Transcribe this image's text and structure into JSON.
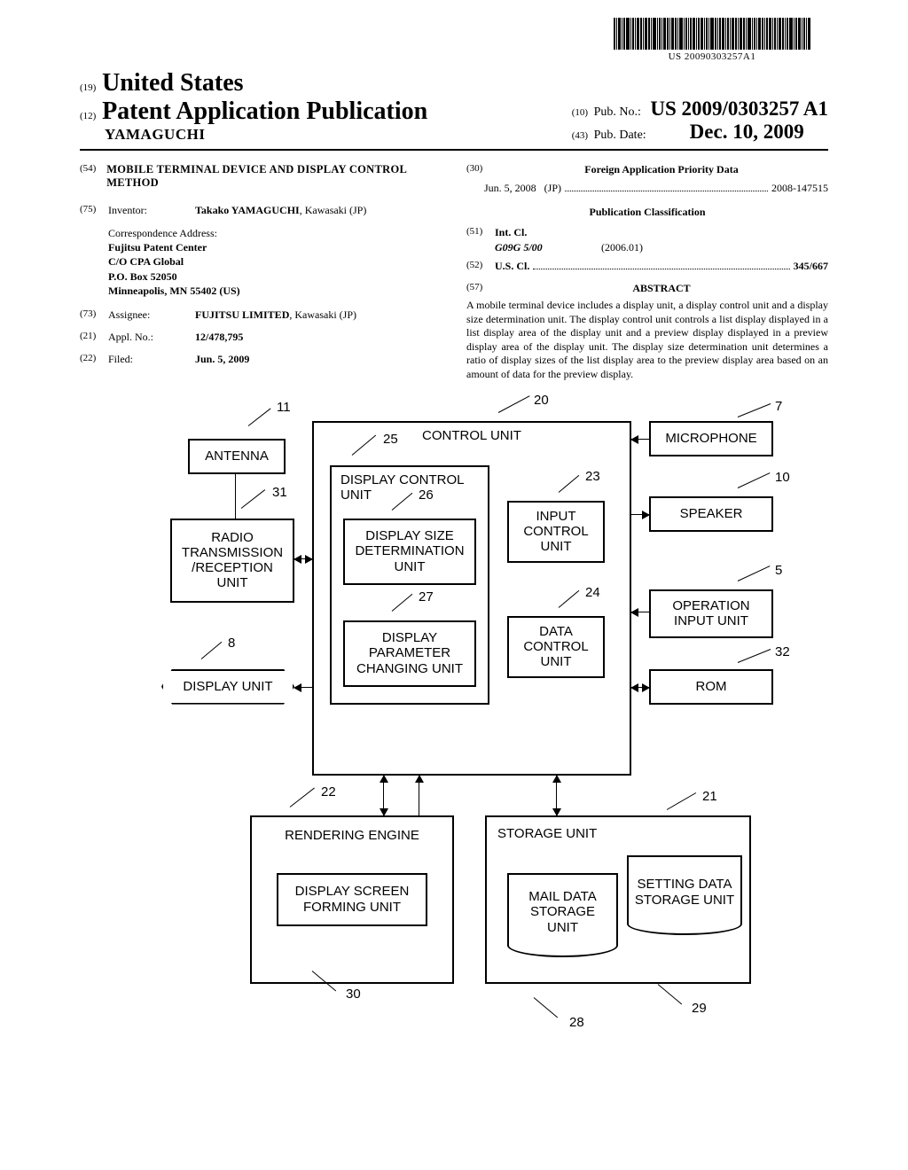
{
  "barcode_text": "US 20090303257A1",
  "header": {
    "country_prefix": "(19)",
    "country": "United States",
    "pub_prefix": "(12)",
    "pub_type": "Patent Application Publication",
    "author": "YAMAGUCHI",
    "pubno_prefix": "(10)",
    "pubno_label": "Pub. No.:",
    "pubno_value": "US 2009/0303257 A1",
    "pubdate_prefix": "(43)",
    "pubdate_label": "Pub. Date:",
    "pubdate_value": "Dec. 10, 2009"
  },
  "biblio": {
    "title_code": "(54)",
    "title": "MOBILE TERMINAL DEVICE AND DISPLAY CONTROL METHOD",
    "inventor_code": "(75)",
    "inventor_label": "Inventor:",
    "inventor_value": "Takako YAMAGUCHI",
    "inventor_loc": ", Kawasaki (JP)",
    "corr_heading": "Correspondence Address:",
    "corr_l1": "Fujitsu Patent Center",
    "corr_l2": "C/O CPA Global",
    "corr_l3": "P.O. Box 52050",
    "corr_l4": "Minneapolis, MN 55402 (US)",
    "assignee_code": "(73)",
    "assignee_label": "Assignee:",
    "assignee_value": "FUJITSU LIMITED",
    "assignee_loc": ", Kawasaki (JP)",
    "applno_code": "(21)",
    "applno_label": "Appl. No.:",
    "applno_value": "12/478,795",
    "filed_code": "(22)",
    "filed_label": "Filed:",
    "filed_value": "Jun. 5, 2009",
    "foreign_code": "(30)",
    "foreign_heading": "Foreign Application Priority Data",
    "foreign_date": "Jun. 5, 2008",
    "foreign_country": "(JP)",
    "foreign_num": "2008-147515",
    "pubclass_heading": "Publication Classification",
    "intcl_code": "(51)",
    "intcl_label": "Int. Cl.",
    "intcl_value": "G09G 5/00",
    "intcl_year": "(2006.01)",
    "uscl_code": "(52)",
    "uscl_label": "U.S. Cl.",
    "uscl_value": "345/667",
    "abstract_code": "(57)",
    "abstract_heading": "ABSTRACT",
    "abstract_text": "A mobile terminal device includes a display unit, a display control unit and a display size determination unit. The display control unit controls a list display displayed in a list display area of the display unit and a preview display displayed in a preview display area of the display unit. The display size determination unit determines a ratio of display sizes of the list display area to the preview display area based on an amount of data for the preview display."
  },
  "diagram": {
    "control_unit": "CONTROL UNIT",
    "antenna": "ANTENNA",
    "radio": "RADIO TRANSMISSION /RECEPTION UNIT",
    "display_unit": "DISPLAY UNIT",
    "display_control": "DISPLAY CONTROL UNIT",
    "display_size": "DISPLAY SIZE DETERMINATION UNIT",
    "display_param": "DISPLAY PARAMETER CHANGING UNIT",
    "input_control": "INPUT CONTROL UNIT",
    "data_control": "DATA CONTROL UNIT",
    "microphone": "MICROPHONE",
    "speaker": "SPEAKER",
    "operation_input": "OPERATION INPUT UNIT",
    "rom": "ROM",
    "rendering_engine": "RENDERING ENGINE",
    "display_screen_forming": "DISPLAY SCREEN FORMING UNIT",
    "storage_unit": "STORAGE UNIT",
    "mail_data_storage": "MAIL DATA STORAGE UNIT",
    "setting_data_storage": "SETTING DATA STORAGE UNIT",
    "r5": "5",
    "r7": "7",
    "r8": "8",
    "r10": "10",
    "r11": "11",
    "r20": "20",
    "r21": "21",
    "r22": "22",
    "r23": "23",
    "r24": "24",
    "r25": "25",
    "r26": "26",
    "r27": "27",
    "r28": "28",
    "r29": "29",
    "r30": "30",
    "r31": "31",
    "r32": "32"
  }
}
